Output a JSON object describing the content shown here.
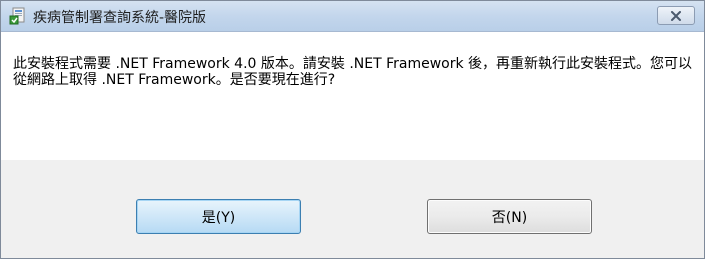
{
  "window": {
    "title": "疾病管制署查詢系統-醫院版"
  },
  "dialog": {
    "message": "此安裝程式需要 .NET Framework 4.0 版本。請安裝 .NET Framework 後，再重新執行此安裝程式。您可以從網路上取得 .NET Framework。是否要現在進行?"
  },
  "buttons": {
    "yes_label": "是(Y)",
    "no_label": "否(N)"
  },
  "icons": {
    "app": "installer-icon",
    "close": "close-icon"
  },
  "colors": {
    "titlebar": "#c3d6ec",
    "button_area": "#f0f0f0",
    "default_button_border": "#3c7fb1"
  }
}
